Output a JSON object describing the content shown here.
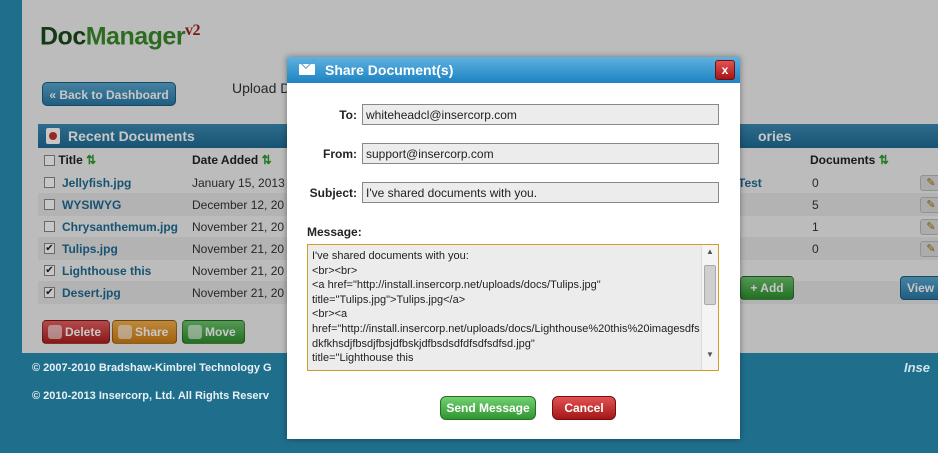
{
  "app": {
    "logo_main": "Doc",
    "logo_accent": "Manager",
    "logo_version": "v2",
    "back_button": "« Back to Dashboard",
    "upload_label": "Upload D",
    "recent_title": "Recent Documents",
    "categories_title": "ories",
    "columns": {
      "title": "Title",
      "date": "Date Added",
      "documents": "Documents"
    },
    "rows": [
      {
        "title": "Jellyfish.jpg",
        "date": "January 15, 2013",
        "checked": false,
        "category": "Test",
        "count": "0"
      },
      {
        "title": "WYSIWYG",
        "date": "December 12, 20",
        "checked": false,
        "category": "",
        "count": "5"
      },
      {
        "title": "Chrysanthemum.jpg",
        "date": "November 21, 20",
        "checked": false,
        "category": "",
        "count": "1"
      },
      {
        "title": "Tulips.jpg",
        "date": "November 21, 20",
        "checked": true,
        "category": "",
        "count": "0"
      },
      {
        "title": "Lighthouse this",
        "date": "November 21, 20",
        "checked": true,
        "category": "",
        "count": ""
      },
      {
        "title": "Desert.jpg",
        "date": "November 21, 20",
        "checked": true,
        "category": "",
        "count": ""
      }
    ],
    "delete_button": "Delete",
    "share_button": "Share",
    "move_button": "Move",
    "add_button": "+ Add",
    "view_button": "View",
    "footer_line1": "© 2007-2010 Bradshaw-Kimbrel Technology G",
    "footer_line2": "© 2010-2013 Insercorp, Ltd. All Rights Reserv",
    "footer_logo": "Inse"
  },
  "modal": {
    "title": "Share Document(s)",
    "close_label": "x",
    "to_label": "To:",
    "to_value": "whiteheadcl@insercorp.com",
    "from_label": "From:",
    "from_value": "support@insercorp.com",
    "subject_label": "Subject:",
    "subject_value": "I've shared documents with you.",
    "message_label": "Message:",
    "message_value": "I've shared documents with you:\n<br><br>\n<a href=\"http://install.insercorp.net/uploads/docs/Tulips.jpg\"\ntitle=\"Tulips.jpg\">Tulips.jpg</a>\n<br><a\nhref=\"http://install.insercorp.net/uploads/docs/Lighthouse%20this%20imagesdfsdkfkhsdjfbsdjfbsjdfbskjdfbsdsdfdfsdfsdfsd.jpg\"\ntitle=\"Lighthouse this",
    "send_button": "Send Message",
    "cancel_button": "Cancel"
  }
}
